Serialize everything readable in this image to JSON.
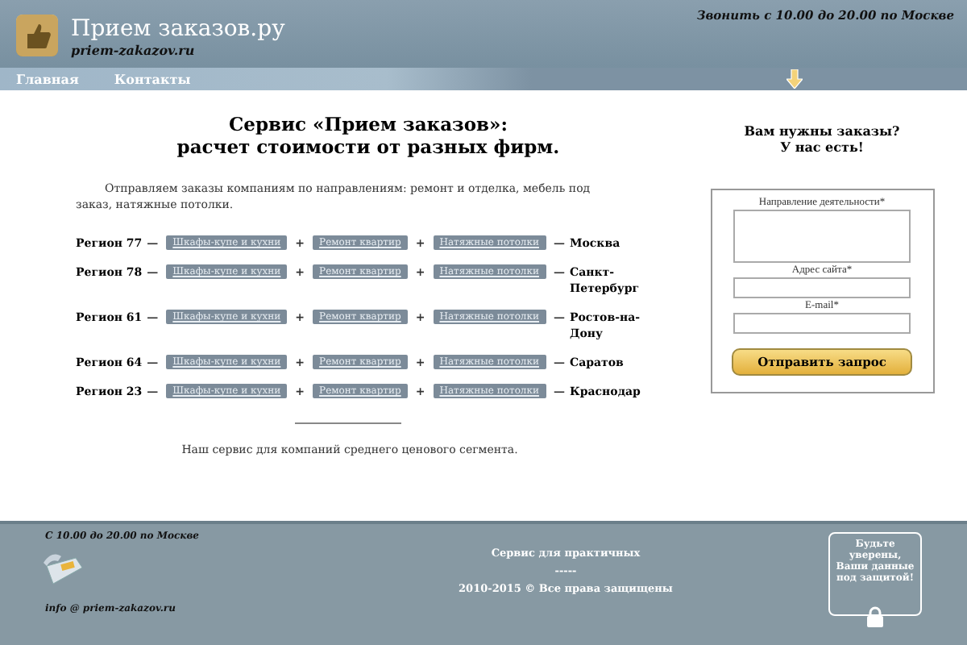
{
  "header": {
    "site_title": "Прием заказов.ру",
    "site_domain": "priem-zakazov.ru",
    "phone_hours": "Звонить с 10.00 до 20.00 по Москве"
  },
  "nav": [
    {
      "label": "Главная"
    },
    {
      "label": "Контакты"
    }
  ],
  "main": {
    "heading": [
      "Сервис «Прием заказов»:",
      "расчет стоимости от разных фирм."
    ],
    "intro": "Отправляем заказы компаниям по направлениям: ремонт и отделка, мебель под заказ, натяжные потолки.",
    "regions": [
      {
        "region": "Регион 77",
        "tags": [
          "Шкафы-купе и кухни",
          "Ремонт квартир",
          "Натяжные потолки"
        ],
        "city": "Москва"
      },
      {
        "region": "Регион 78",
        "tags": [
          "Шкафы-купе и кухни",
          "Ремонт квартир",
          "Натяжные потолки"
        ],
        "city": "Санкт-Петербург"
      },
      {
        "region": "Регион 61",
        "tags": [
          "Шкафы-купе и кухни",
          "Ремонт квартир",
          "Натяжные потолки"
        ],
        "city": "Ростов-на-Дону"
      },
      {
        "region": "Регион 64",
        "tags": [
          "Шкафы-купе и кухни",
          "Ремонт квартир",
          "Натяжные потолки"
        ],
        "city": "Саратов"
      },
      {
        "region": "Регион 23",
        "tags": [
          "Шкафы-купе и кухни",
          "Ремонт квартир",
          "Натяжные потолки"
        ],
        "city": "Краснодар"
      }
    ],
    "dash": "—",
    "plus": "+",
    "footer_note": "Наш сервис для компаний среднего ценового сегмента."
  },
  "form": {
    "heading": [
      "Вам нужны заказы?",
      "У нас есть!"
    ],
    "fields": [
      {
        "kind": "textarea",
        "label": "Направление деятельности*"
      },
      {
        "kind": "input",
        "label": "Адрес сайта*"
      },
      {
        "kind": "input",
        "label": "E-mail*"
      }
    ],
    "submit": "Отправить запрос"
  },
  "footer": {
    "hours": "С 10.00 до 20.00 по Москве",
    "email": "info @ priem-zakazov.ru",
    "center": [
      "Сервис для практичных",
      "-----",
      "2010-2015 © Все права защищены"
    ],
    "badge": [
      "Будьте",
      "уверены,",
      "Ваши данные",
      "под защитой!"
    ]
  }
}
